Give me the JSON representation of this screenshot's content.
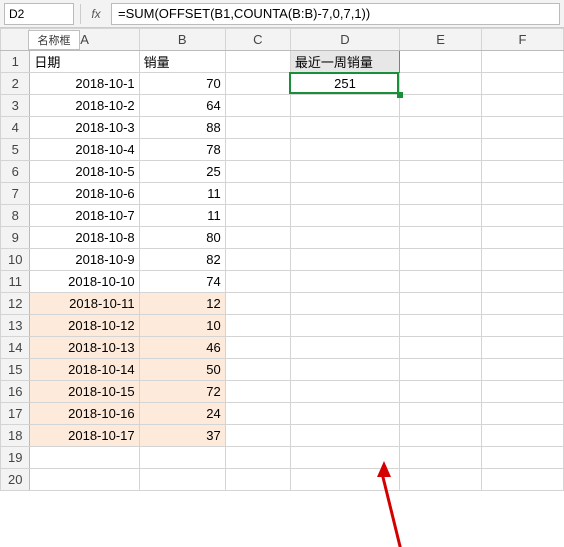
{
  "nameBox": "D2",
  "nameBoxLabel": "名称框",
  "fxLabel": "fx",
  "formula": "=SUM(OFFSET(B1,COUNTA(B:B)-7,0,7,1))",
  "columns": [
    "A",
    "B",
    "C",
    "D",
    "E",
    "F"
  ],
  "headers": {
    "A1": "日期",
    "B1": "销量",
    "D1": "最近一周销量"
  },
  "d2": "251",
  "rows": [
    {
      "n": "1"
    },
    {
      "n": "2",
      "date": "2018-10-1",
      "qty": "70"
    },
    {
      "n": "3",
      "date": "2018-10-2",
      "qty": "64"
    },
    {
      "n": "4",
      "date": "2018-10-3",
      "qty": "88"
    },
    {
      "n": "5",
      "date": "2018-10-4",
      "qty": "78"
    },
    {
      "n": "6",
      "date": "2018-10-5",
      "qty": "25"
    },
    {
      "n": "7",
      "date": "2018-10-6",
      "qty": "11"
    },
    {
      "n": "8",
      "date": "2018-10-7",
      "qty": "11"
    },
    {
      "n": "9",
      "date": "2018-10-8",
      "qty": "80"
    },
    {
      "n": "10",
      "date": "2018-10-9",
      "qty": "82"
    },
    {
      "n": "11",
      "date": "2018-10-10",
      "qty": "74"
    },
    {
      "n": "12",
      "date": "2018-10-11",
      "qty": "12",
      "hl": true
    },
    {
      "n": "13",
      "date": "2018-10-12",
      "qty": "10",
      "hl": true
    },
    {
      "n": "14",
      "date": "2018-10-13",
      "qty": "46",
      "hl": true
    },
    {
      "n": "15",
      "date": "2018-10-14",
      "qty": "50",
      "hl": true
    },
    {
      "n": "16",
      "date": "2018-10-15",
      "qty": "72",
      "hl": true
    },
    {
      "n": "17",
      "date": "2018-10-16",
      "qty": "24",
      "hl": true
    },
    {
      "n": "18",
      "date": "2018-10-17",
      "qty": "37",
      "hl": true
    },
    {
      "n": "19"
    },
    {
      "n": "20"
    }
  ]
}
